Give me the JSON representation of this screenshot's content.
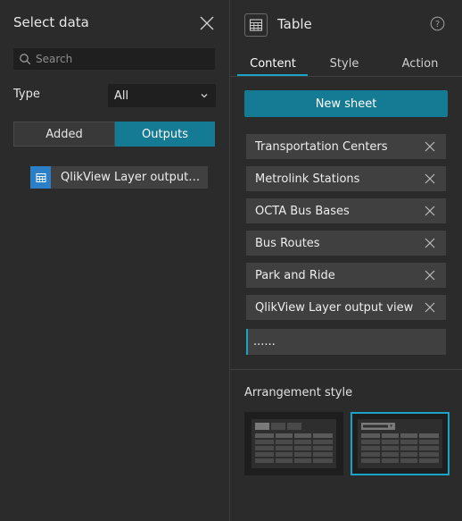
{
  "left_panel": {
    "title": "Select data",
    "search": {
      "placeholder": "Search",
      "value": ""
    },
    "type_label": "Type",
    "type_select": {
      "value": "All"
    },
    "segmented": {
      "added_label": "Added",
      "outputs_label": "Outputs",
      "active": "outputs"
    },
    "layers": [
      {
        "label": "QlikView Layer output…",
        "icon": "table-icon"
      }
    ]
  },
  "right_panel": {
    "title": "Table",
    "header_icon": "table-icon",
    "tabs": [
      {
        "label": "Content",
        "active": true
      },
      {
        "label": "Style",
        "active": false
      },
      {
        "label": "Action",
        "active": false
      }
    ],
    "new_sheet_label": "New sheet",
    "sheets": [
      {
        "label": "Transportation Centers"
      },
      {
        "label": "Metrolink Stations"
      },
      {
        "label": "OCTA Bus Bases"
      },
      {
        "label": "Bus Routes"
      },
      {
        "label": "Park and Ride"
      },
      {
        "label": "QlikView Layer output view"
      }
    ],
    "sheet_input_value": "......",
    "arrangement_label": "Arrangement style",
    "arrangement_selected": 2
  },
  "colors": {
    "accent": "#157a93",
    "accent_bright": "#1aa3c4",
    "panel_bg": "#2b2b2b",
    "item_bg": "#404040",
    "layer_icon_bg": "#2a7fc7"
  }
}
